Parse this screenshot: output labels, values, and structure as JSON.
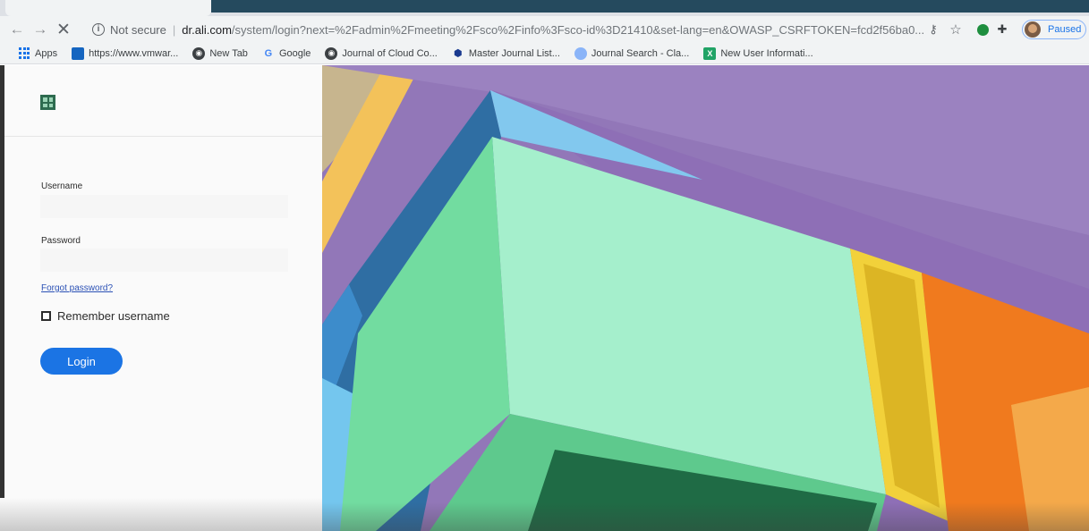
{
  "browser": {
    "url": {
      "security_label": "Not secure",
      "host": "dr.ali.com",
      "path": "/system/login?next=%2Fadmin%2Fmeeting%2Fsco%2Finfo%3Fsco-id%3D21410&set-lang=en&OWASP_CSRFTOKEN=fcd2f56ba0..."
    },
    "profile": {
      "status": "Paused"
    },
    "bookmarks": [
      {
        "label": "Apps",
        "icon": "apps-grid-icon"
      },
      {
        "label": "https://www.vmwar...",
        "icon": "vmware-icon"
      },
      {
        "label": "New Tab",
        "icon": "globe-icon"
      },
      {
        "label": "Google",
        "icon": "google-icon"
      },
      {
        "label": "Journal of Cloud Co...",
        "icon": "globe-icon"
      },
      {
        "label": "Master Journal List...",
        "icon": "hexagon-icon"
      },
      {
        "label": "Journal Search - Cla...",
        "icon": "globe-icon"
      },
      {
        "label": "New User Informati...",
        "icon": "excel-icon"
      }
    ]
  },
  "login": {
    "username_label": "Username",
    "username_value": "",
    "password_label": "Password",
    "password_value": "",
    "forgot_label": "Forgot password?",
    "remember_label": "Remember username",
    "remember_checked": false,
    "login_label": "Login"
  },
  "colors": {
    "login_button": "#1b74e4",
    "logo": "#2d6b4f",
    "hero_purple": "#9277b8",
    "hero_green": "#6fdc9f",
    "hero_orange": "#f07a1e",
    "hero_yellow": "#f2d13a",
    "hero_blue": "#3f8fcc"
  }
}
